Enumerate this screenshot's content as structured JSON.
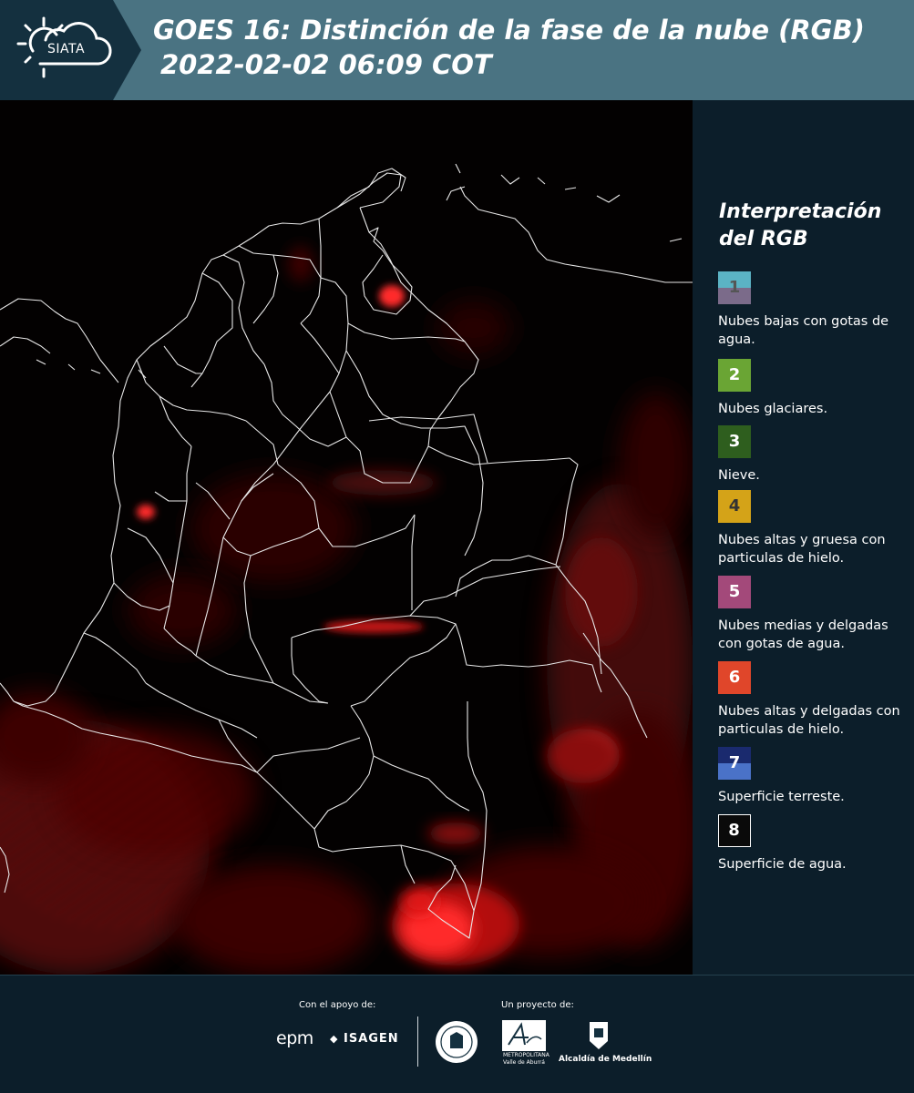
{
  "header": {
    "logo_text": "SIATA",
    "title_line1": "GOES 16: Distinción de la fase de la nube (RGB)",
    "title_line2": "2022-02-02 06:09 COT"
  },
  "legend": {
    "title": "Interpretación del RGB",
    "items": [
      {
        "number": "1",
        "label": "Nubes bajas con gotas de agua.",
        "color_top": "#5bb3c4",
        "color_bottom": "#7b6b8a"
      },
      {
        "number": "2",
        "label": "Nubes glaciares.",
        "color_top": "#6aa534",
        "color_bottom": "#6aa534"
      },
      {
        "number": "3",
        "label": "Nieve.",
        "color_top": "#2e5e1e",
        "color_bottom": "#2e5e1e"
      },
      {
        "number": "4",
        "label": "Nubes altas y gruesa con particulas de hielo.",
        "color_top": "#d4a318",
        "color_bottom": "#d4a318"
      },
      {
        "number": "5",
        "label": "Nubes medias y delgadas con gotas de agua.",
        "color_top": "#a3497a",
        "color_bottom": "#a3497a"
      },
      {
        "number": "6",
        "label": "Nubes altas y delgadas con particulas de hielo.",
        "color_top": "#e0462a",
        "color_bottom": "#e0462a"
      },
      {
        "number": "7",
        "label": "Superficie terreste.",
        "color_top": "#1a2a6e",
        "color_bottom": "#4a72c8"
      },
      {
        "number": "8",
        "label": "Superficie de agua.",
        "color_top": "#0a0a0a",
        "color_bottom": "#0a0a0a"
      }
    ]
  },
  "footer": {
    "support_label": "Con el apoyo de:",
    "project_label": "Un proyecto de:",
    "epm": "epm",
    "isagen": "ISAGEN",
    "area_text": "METROPOLITANA Valle de Aburrá",
    "medellin": "Alcaldía de Medellín"
  }
}
